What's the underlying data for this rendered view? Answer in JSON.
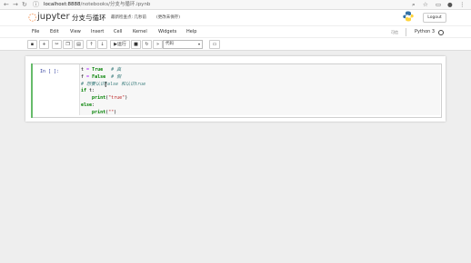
{
  "browser": {
    "url_host": "localhost:8888",
    "url_path": "/notebooks/分支与循环.ipynb"
  },
  "header": {
    "brand": "jupyter",
    "notebook_title": "分支与循环",
    "checkpoint": "最新检查点: 几秒前",
    "unsaved": "(更改未保存)",
    "logout": "Logout"
  },
  "menu": {
    "items": [
      "File",
      "Edit",
      "View",
      "Insert",
      "Cell",
      "Kernel",
      "Widgets",
      "Help"
    ],
    "trusted": "可信",
    "kernel_name": "Python 3"
  },
  "toolbar": {
    "run_label": "运行",
    "cell_type": "代码"
  },
  "cell": {
    "prompt": "In [ ]:",
    "code_lines": [
      "t = True   # 真",
      "f = False  # 假",
      "# 想要认识false 和认识true",
      "if t:",
      "    print(\"true\")",
      "else:",
      "    print(\"\")"
    ]
  },
  "colors": {
    "jupyter_orange": "#f37726",
    "cell_edit_border": "#66bb6a",
    "keyword": "#008000",
    "comment": "#408080",
    "string": "#ba2121"
  }
}
